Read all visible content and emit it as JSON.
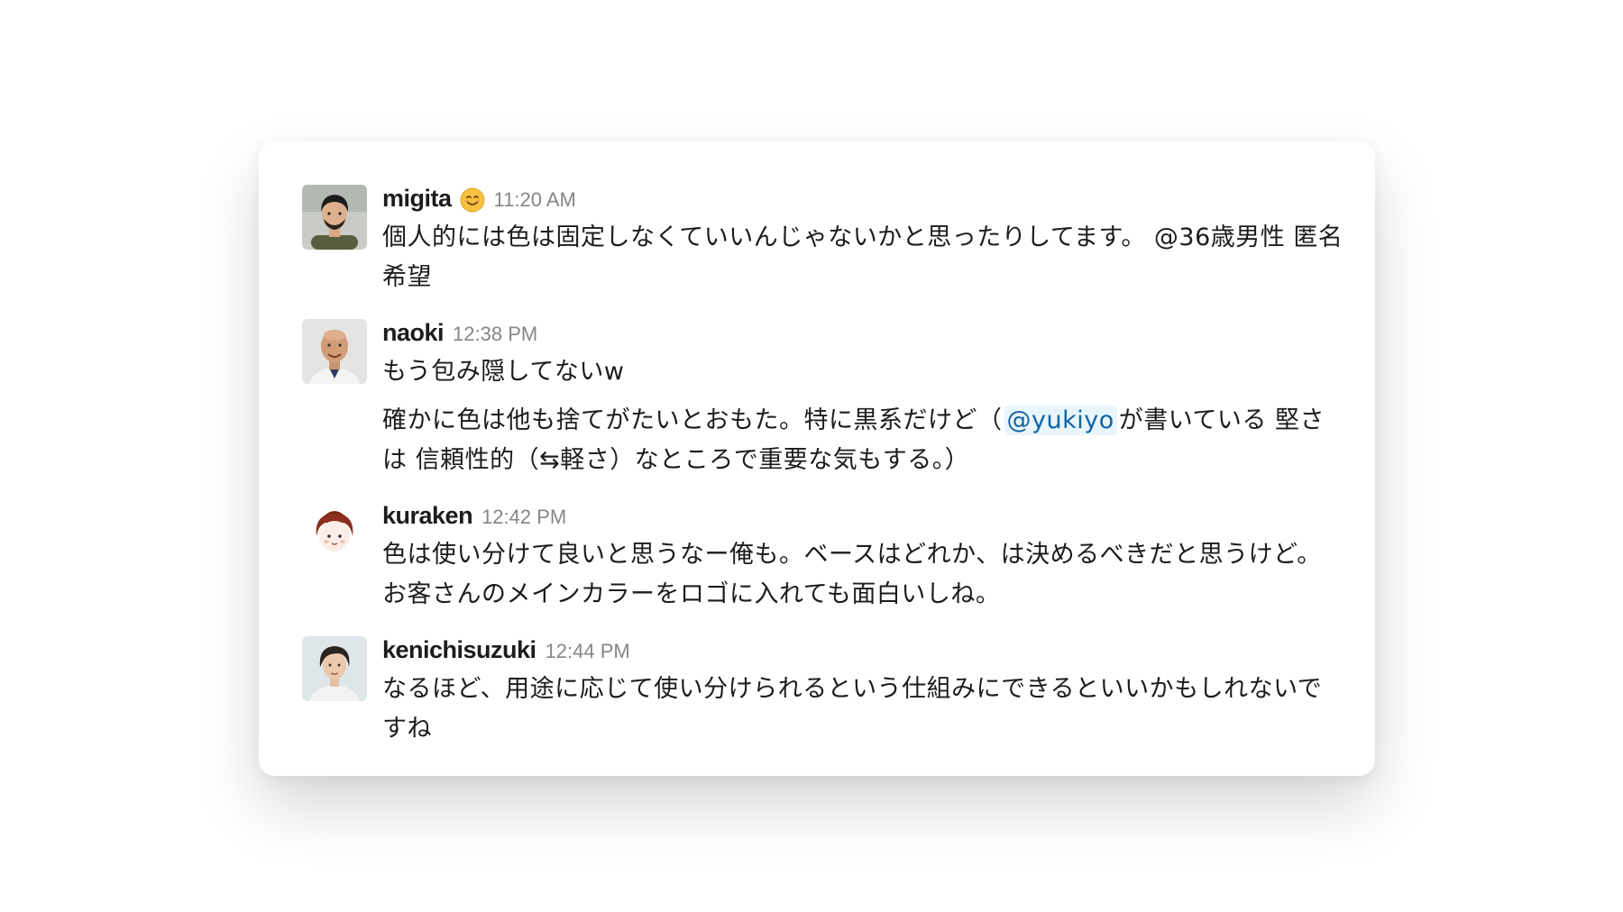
{
  "messages": [
    {
      "user": "migita",
      "status_emoji": "smiling-face-emoji",
      "time": "11:20 AM",
      "lines": [
        "個人的には色は固定しなくていいんじゃないかと思ったりしてます。 @36歳男性 匿名希望"
      ]
    },
    {
      "user": "naoki",
      "time": "12:38 PM",
      "lines": [
        "もう包み隠してないw"
      ],
      "second": {
        "before": "確かに色は他も捨てがたいとおもた。特に黒系だけど（",
        "mention": "@yukiyo",
        "after": "が書いている 堅さ は 信頼性的（⇆軽さ）なところで重要な気もする。）"
      }
    },
    {
      "user": "kuraken",
      "time": "12:42 PM",
      "lines": [
        "色は使い分けて良いと思うなー俺も。ベースはどれか、は決めるべきだと思うけど。お客さんのメインカラーをロゴに入れても面白いしね。"
      ]
    },
    {
      "user": "kenichisuzuki",
      "time": "12:44 PM",
      "lines": [
        "なるほど、用途に応じて使い分けられるという仕組みにできるといいかもしれないですね"
      ]
    }
  ],
  "colors": {
    "mention_text": "#1264a3",
    "mention_bg": "#e8f5fa",
    "timestamp": "#868686",
    "text": "#1d1c1d"
  }
}
